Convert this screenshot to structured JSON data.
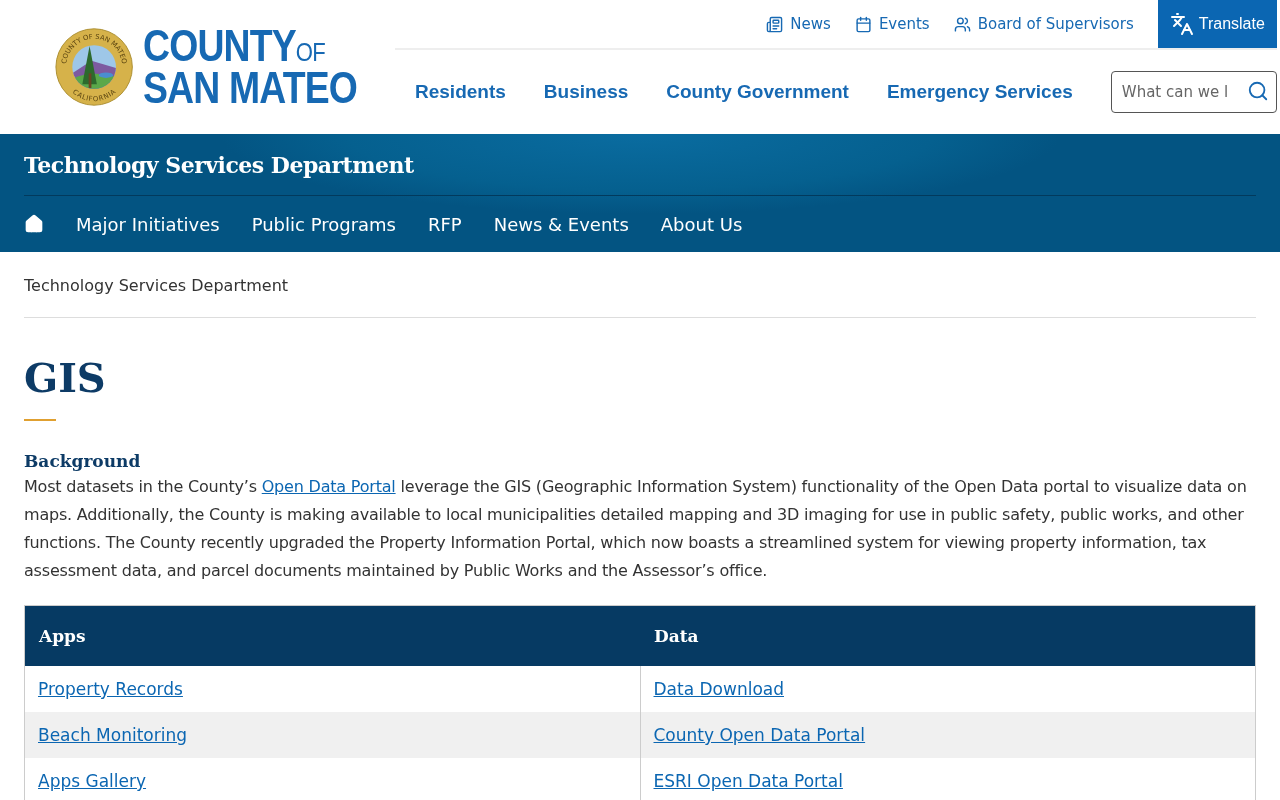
{
  "logo": {
    "seal_top": "COUNTY OF SAN MATEO",
    "seal_bottom": "CALIFORNIA",
    "line1": "COUNTY",
    "of": "OF",
    "line2": "SAN MATEO"
  },
  "utility_links": [
    {
      "label": "News"
    },
    {
      "label": "Events"
    },
    {
      "label": "Board of Supervisors"
    }
  ],
  "translate_button": "Translate",
  "main_nav": [
    "Residents",
    "Business",
    "County Government",
    "Emergency Services"
  ],
  "search": {
    "placeholder": "What can we l"
  },
  "department": {
    "title": "Technology Services Department",
    "nav": [
      "Major Initiatives",
      "Public Programs",
      "RFP",
      "News & Events",
      "About Us"
    ]
  },
  "breadcrumb": "Technology Services Department",
  "page_title": "GIS",
  "section_heading": "Background",
  "paragraph": {
    "before": "Most datasets in the County’s ",
    "link": "Open Data Portal",
    "after": " leverage the GIS (Geographic Information System) functionality of the Open Data portal to visualize data on maps. Additionally, the County is making available to local municipalities detailed mapping and 3D imaging for use in public safety, public works, and other functions. The County recently upgraded the Property Information Portal, which now boasts a streamlined system for viewing property information, tax assessment data, and parcel documents maintained by Public Works and the Assessor’s office."
  },
  "table": {
    "columns": [
      "Apps",
      "Data"
    ],
    "rows": [
      [
        "Property Records",
        "Data Download"
      ],
      [
        "Beach Monitoring",
        "County Open Data Portal"
      ],
      [
        "Apps Gallery",
        "ESRI Open Data Portal"
      ]
    ]
  }
}
